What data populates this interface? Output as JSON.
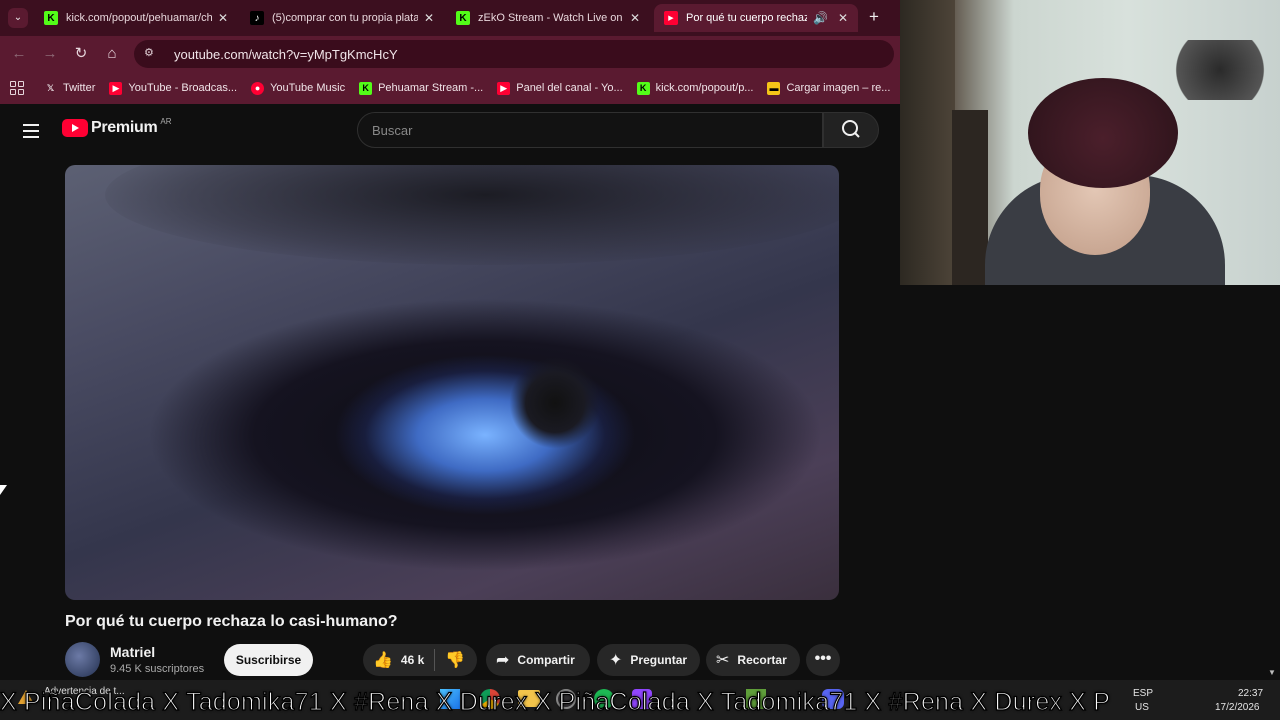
{
  "browser": {
    "tabs": [
      {
        "title": "kick.com/popout/pehuamar/ch",
        "favicon": "kick-icon",
        "active": false
      },
      {
        "title": "(5)comprar con tu propia plata",
        "favicon": "tiktok-icon",
        "active": false
      },
      {
        "title": "zEkO Stream - Watch Live on K",
        "favicon": "kick-icon",
        "active": false
      },
      {
        "title": "Por qué tu cuerpo rechaza l",
        "favicon": "youtube-icon",
        "active": true
      }
    ],
    "new_tab": "+",
    "close": "✕",
    "url": "youtube.com/watch?v=yMpTgKmcHcY",
    "bookmarks": [
      {
        "label": "Twitter",
        "favicon": "x-icon"
      },
      {
        "label": "YouTube - Broadcas...",
        "favicon": "youtube-icon"
      },
      {
        "label": "YouTube Music",
        "favicon": "youtube-music-icon"
      },
      {
        "label": "Pehuamar Stream -...",
        "favicon": "kick-icon"
      },
      {
        "label": "Panel del canal - Yo...",
        "favicon": "youtube-icon"
      },
      {
        "label": "kick.com/popout/p...",
        "favicon": "kick-icon"
      },
      {
        "label": "Cargar imagen – re...",
        "favicon": "image-upload-icon"
      }
    ]
  },
  "youtube": {
    "logo_text": "Premium",
    "country_code": "AR",
    "search_placeholder": "Buscar",
    "video_title": "Por qué tu cuerpo rechaza lo casi-humano?",
    "channel_name": "Matriel",
    "subscribers": "9.45 K suscriptores",
    "subscribe_label": "Suscribirse",
    "likes": "46 k",
    "share_label": "Compartir",
    "ask_label": "Preguntar",
    "clip_label": "Recortar",
    "more_label": "•••"
  },
  "taskbar": {
    "notification": "Advertencia de t...",
    "lang_top": "ESP",
    "lang_bottom": "US",
    "time": "22:37",
    "date": "17/2/2026"
  },
  "ticker": {
    "text": "X PiñaColada X Tadomika71 X #Rena X Durex X PiñaColada X Tadomika71 X #Rena X Durex X P"
  },
  "colors": {
    "chrome_frame": "#3c0f1f",
    "chrome_toolbar": "#5a1a30",
    "youtube_red": "#ff0033",
    "kick_green": "#53fc18",
    "page_bg": "#0f0f0f"
  }
}
